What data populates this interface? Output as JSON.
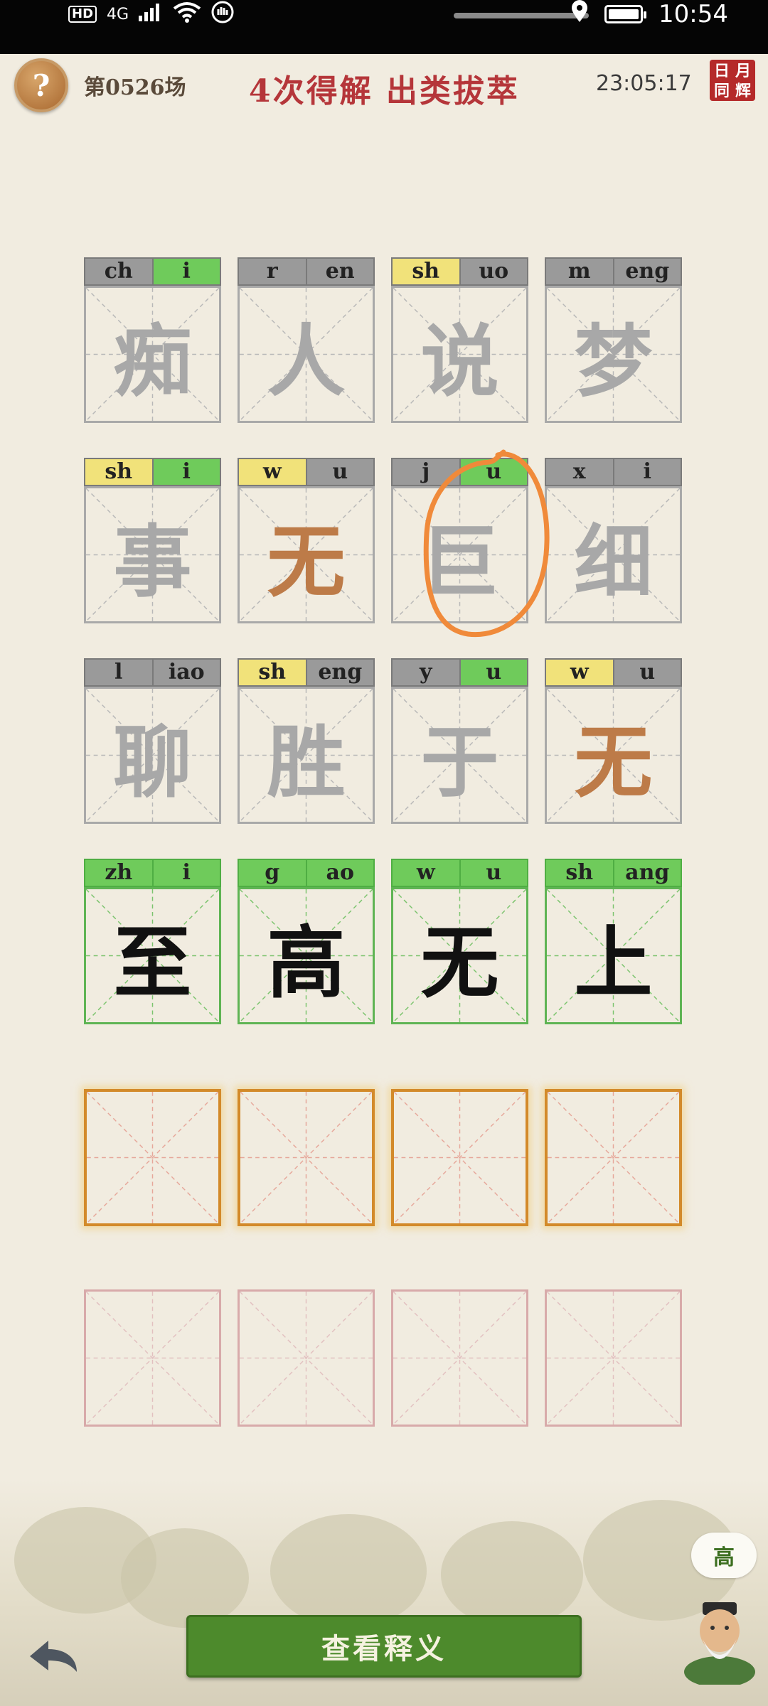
{
  "status": {
    "hd": "HD",
    "network": "4G",
    "time": "10:54"
  },
  "header": {
    "help_icon": "?",
    "round": "第0526场",
    "result": "4次得解  出类拔萃",
    "timer": "23:05:17",
    "seal": [
      "日",
      "月",
      "同",
      "辉"
    ]
  },
  "guesses": [
    [
      {
        "initial": "ch",
        "final": "i",
        "initial_state": "gray",
        "final_state": "green",
        "char": "痴",
        "char_state": "gray"
      },
      {
        "initial": "r",
        "final": "en",
        "initial_state": "gray",
        "final_state": "gray",
        "char": "人",
        "char_state": "gray"
      },
      {
        "initial": "sh",
        "final": "uo",
        "initial_state": "yellow",
        "final_state": "gray",
        "char": "说",
        "char_state": "gray"
      },
      {
        "initial": "m",
        "final": "eng",
        "initial_state": "gray",
        "final_state": "gray",
        "char": "梦",
        "char_state": "gray"
      }
    ],
    [
      {
        "initial": "sh",
        "final": "i",
        "initial_state": "yellow",
        "final_state": "green",
        "char": "事",
        "char_state": "gray"
      },
      {
        "initial": "w",
        "final": "u",
        "initial_state": "yellow",
        "final_state": "gray",
        "char": "无",
        "char_state": "orange"
      },
      {
        "initial": "j",
        "final": "u",
        "initial_state": "gray",
        "final_state": "green",
        "char": "巨",
        "char_state": "gray"
      },
      {
        "initial": "x",
        "final": "i",
        "initial_state": "gray",
        "final_state": "gray",
        "char": "细",
        "char_state": "gray"
      }
    ],
    [
      {
        "initial": "l",
        "final": "iao",
        "initial_state": "gray",
        "final_state": "gray",
        "char": "聊",
        "char_state": "gray"
      },
      {
        "initial": "sh",
        "final": "eng",
        "initial_state": "yellow",
        "final_state": "gray",
        "char": "胜",
        "char_state": "gray"
      },
      {
        "initial": "y",
        "final": "u",
        "initial_state": "gray",
        "final_state": "green",
        "char": "于",
        "char_state": "gray"
      },
      {
        "initial": "w",
        "final": "u",
        "initial_state": "yellow",
        "final_state": "gray",
        "char": "无",
        "char_state": "orange"
      }
    ],
    [
      {
        "initial": "zh",
        "final": "i",
        "initial_state": "green",
        "final_state": "green",
        "char": "至",
        "char_state": "black"
      },
      {
        "initial": "g",
        "final": "ao",
        "initial_state": "green",
        "final_state": "green",
        "char": "高",
        "char_state": "black"
      },
      {
        "initial": "w",
        "final": "u",
        "initial_state": "green",
        "final_state": "green",
        "char": "无",
        "char_state": "black"
      },
      {
        "initial": "sh",
        "final": "ang",
        "initial_state": "green",
        "final_state": "green",
        "char": "上",
        "char_state": "black"
      }
    ]
  ],
  "footer": {
    "explain_button": "查看释义",
    "bubble": "高"
  },
  "colors": {
    "gray": "#9a9a9a",
    "yellow": "#f1e27a",
    "green": "#6fcb5b",
    "orange_char": "#bd7b48",
    "title_red": "#b5363a",
    "button_green": "#4d8a2c"
  }
}
